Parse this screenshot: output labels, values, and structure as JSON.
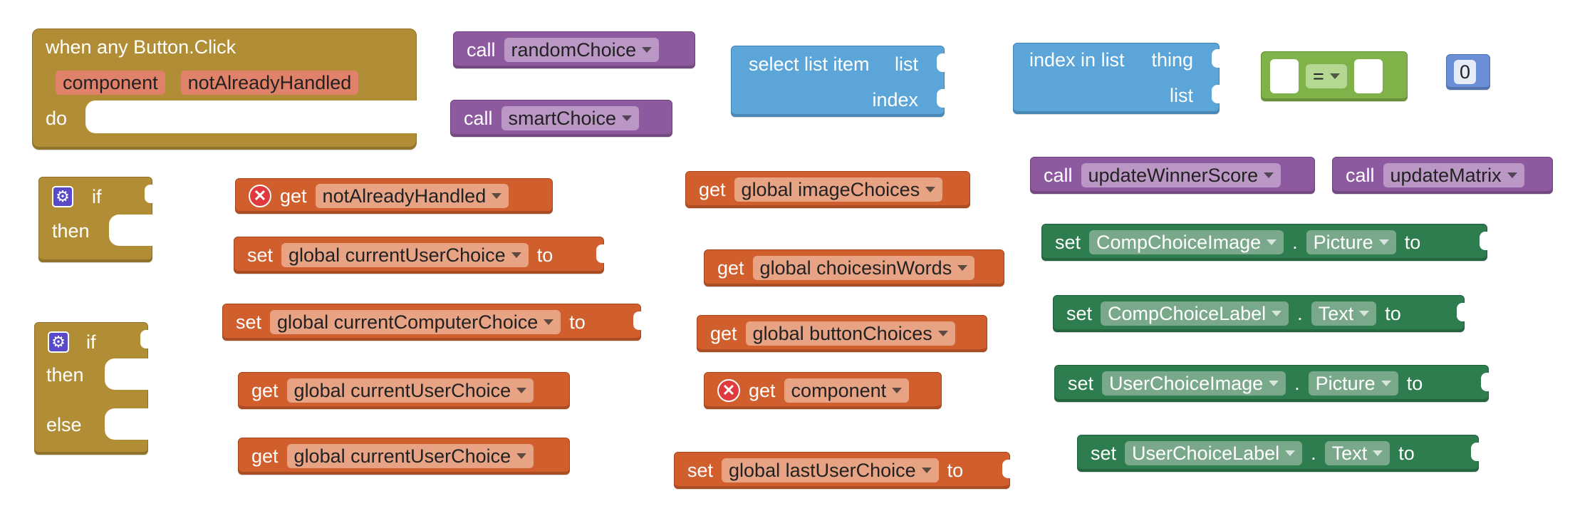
{
  "event": {
    "when": "when any Button.Click",
    "params": [
      "component",
      "notAlreadyHandled"
    ],
    "do": "do"
  },
  "if1": {
    "if": "if",
    "then": "then"
  },
  "if2": {
    "if": "if",
    "then": "then",
    "else": "else"
  },
  "call_random": {
    "kw": "call",
    "name": "randomChoice"
  },
  "call_smart": {
    "kw": "call",
    "name": "smartChoice"
  },
  "select_list": {
    "title": "select list item",
    "list": "list",
    "index": "index"
  },
  "index_in_list": {
    "title": "index in list",
    "thing": "thing",
    "list": "list"
  },
  "compare": {
    "op": "="
  },
  "number": {
    "value": "0"
  },
  "get_not_handled": {
    "kw": "get",
    "name": "notAlreadyHandled"
  },
  "set_current_user": {
    "kw": "set",
    "name": "global currentUserChoice",
    "to": "to"
  },
  "set_current_computer": {
    "kw": "set",
    "name": "global currentComputerChoice",
    "to": "to"
  },
  "get_current_user_1": {
    "kw": "get",
    "name": "global currentUserChoice"
  },
  "get_current_user_2": {
    "kw": "get",
    "name": "global currentUserChoice"
  },
  "get_image_choices": {
    "kw": "get",
    "name": "global imageChoices"
  },
  "get_choices_words": {
    "kw": "get",
    "name": "global choicesinWords"
  },
  "get_button_choices": {
    "kw": "get",
    "name": "global buttonChoices"
  },
  "get_component": {
    "kw": "get",
    "name": "component"
  },
  "set_last_user": {
    "kw": "set",
    "name": "global lastUserChoice",
    "to": "to"
  },
  "call_update_winner": {
    "kw": "call",
    "name": "updateWinnerScore"
  },
  "call_update_matrix": {
    "kw": "call",
    "name": "updateMatrix"
  },
  "set_comp_image": {
    "kw": "set",
    "component": "CompChoiceImage",
    "dot": ".",
    "prop": "Picture",
    "to": "to"
  },
  "set_comp_label": {
    "kw": "set",
    "component": "CompChoiceLabel",
    "dot": ".",
    "prop": "Text",
    "to": "to"
  },
  "set_user_image": {
    "kw": "set",
    "component": "UserChoiceImage",
    "dot": ".",
    "prop": "Picture",
    "to": "to"
  },
  "set_user_label": {
    "kw": "set",
    "component": "UserChoiceLabel",
    "dot": ".",
    "prop": "Text",
    "to": "to"
  },
  "icons": {
    "gear": "gear-icon",
    "error": "error-x-icon",
    "dropdown": "chevron-down-icon"
  }
}
